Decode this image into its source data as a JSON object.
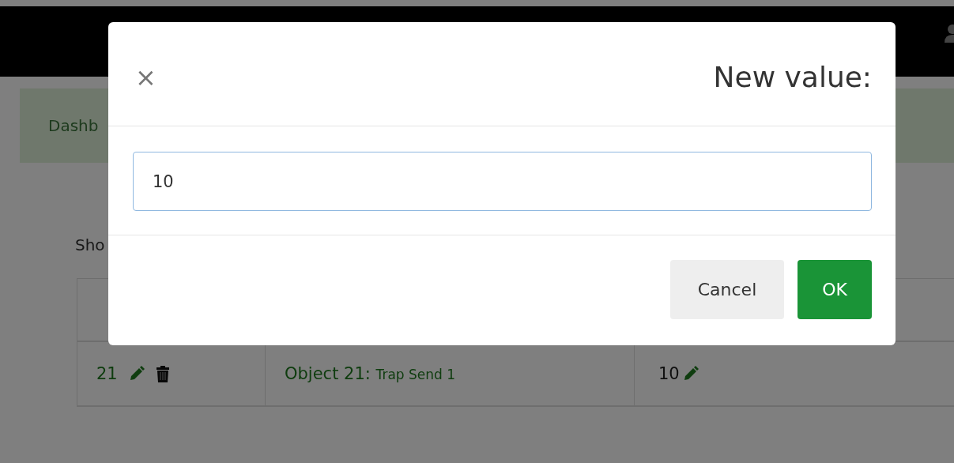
{
  "breadcrumb": {
    "text": "Dashb"
  },
  "show_entries": {
    "text": "Sho"
  },
  "table": {
    "rows": [
      {
        "id": "21",
        "object": "Object 21:",
        "description": "Trap Send 1",
        "value": "10"
      }
    ]
  },
  "dialog": {
    "close": "×",
    "title": "New value:",
    "input": {
      "value": "10"
    },
    "buttons": [
      {
        "label": "Cancel",
        "kind": "secondary"
      },
      {
        "label": "OK",
        "kind": "primary"
      }
    ]
  }
}
